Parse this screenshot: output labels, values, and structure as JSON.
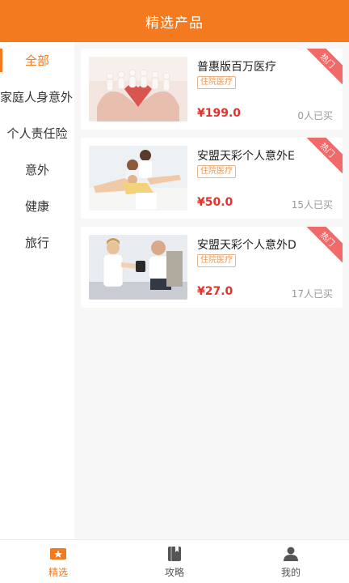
{
  "header": {
    "title": "精选产品"
  },
  "sidebar": {
    "items": [
      {
        "label": "全部",
        "active": true
      },
      {
        "label": "家庭人身意外",
        "active": false
      },
      {
        "label": "个人责任险",
        "active": false
      },
      {
        "label": "意外",
        "active": false
      },
      {
        "label": "健康",
        "active": false
      },
      {
        "label": "旅行",
        "active": false
      }
    ]
  },
  "products": [
    {
      "title": "普惠版百万医疗",
      "tag": "住院医疗",
      "price": "¥199.0",
      "sold": "0人已买",
      "badge": "热门"
    },
    {
      "title": "安盟天彩个人意外E",
      "tag": "住院医疗",
      "price": "¥50.0",
      "sold": "15人已买",
      "badge": "热门"
    },
    {
      "title": "安盟天彩个人意外D",
      "tag": "住院医疗",
      "price": "¥27.0",
      "sold": "17人已买",
      "badge": "热门"
    }
  ],
  "tabbar": {
    "tabs": [
      {
        "label": "精选",
        "icon": "star-ticket-icon",
        "active": true
      },
      {
        "label": "攻略",
        "icon": "book-icon",
        "active": false
      },
      {
        "label": "我的",
        "icon": "person-icon",
        "active": false
      }
    ]
  },
  "colors": {
    "accent": "#f47a1f",
    "price": "#e2322b",
    "badge": "#f16a6a"
  }
}
